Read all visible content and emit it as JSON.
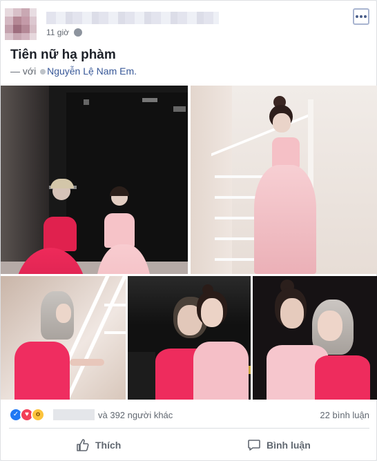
{
  "post": {
    "time": "11 giờ",
    "title": "Tiên nữ hạ phàm",
    "with_prefix": "— với",
    "tagged": "Nguyễn Lệ Nam Em."
  },
  "stats": {
    "others": "và 392 người khác",
    "comments": "22 bình luận"
  },
  "actions": {
    "like": "Thích",
    "comment": "Bình luận"
  }
}
